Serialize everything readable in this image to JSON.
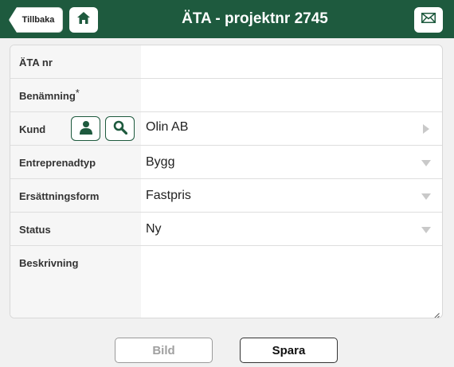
{
  "header": {
    "back_label": "Tillbaka",
    "title": "ÄTA - projektnr 2745",
    "accent_color": "#1e5a3e",
    "icons": {
      "home": "home-icon",
      "mail": "mail-icon"
    }
  },
  "form": {
    "ata_nr": {
      "label": "ÄTA nr",
      "value": ""
    },
    "benamning": {
      "label": "Benämning",
      "required_mark": "*",
      "value": ""
    },
    "kund": {
      "label": "Kund",
      "value": "Olin AB",
      "icons": [
        "person-icon",
        "search-icon"
      ]
    },
    "entreprenadtyp": {
      "label": "Entreprenadtyp",
      "value": "Bygg"
    },
    "ersattningsform": {
      "label": "Ersättningsform",
      "value": "Fastpris"
    },
    "status": {
      "label": "Status",
      "value": "Ny"
    },
    "beskrivning": {
      "label": "Beskrivning",
      "value": ""
    }
  },
  "actions": {
    "bild_label": "Bild",
    "spara_label": "Spara"
  }
}
